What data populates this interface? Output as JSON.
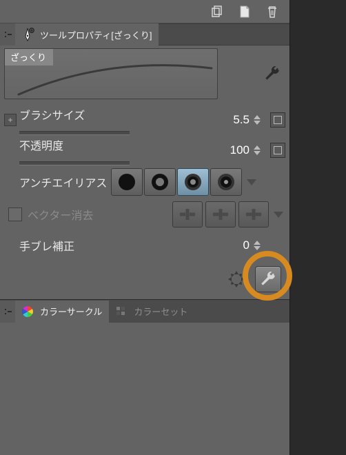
{
  "panel": {
    "title_label": "ツールプロパティ[ざっくり]",
    "preset_name": "ざっくり"
  },
  "props": {
    "brush_size": {
      "label": "ブラシサイズ",
      "value": "5.5"
    },
    "opacity": {
      "label": "不透明度",
      "value": "100"
    },
    "antialias": {
      "label": "アンチエイリアス",
      "selected_index": 2
    },
    "vector_erase": {
      "label": "ベクター消去",
      "checked": false,
      "enabled": false
    },
    "stabilization": {
      "label": "手ブレ補正",
      "value": "0"
    }
  },
  "color_panel": {
    "tab_circle": "カラーサークル",
    "tab_set": "カラーセット"
  }
}
